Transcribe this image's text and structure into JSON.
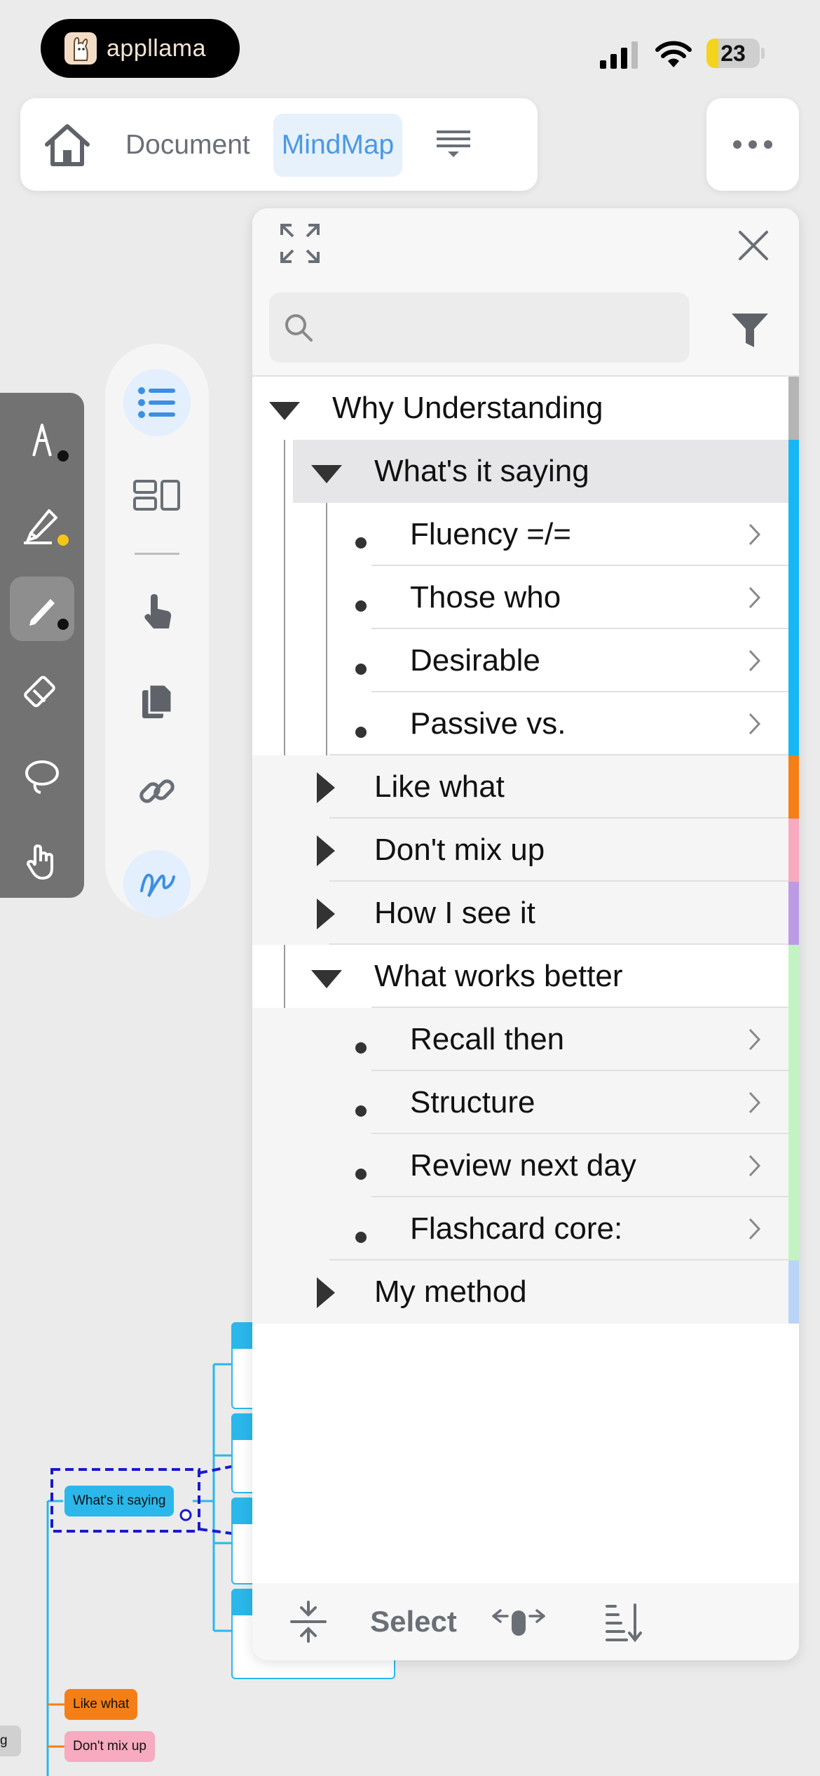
{
  "status_bar": {
    "brand": "appllama",
    "battery": "23",
    "battery_level": 0.23
  },
  "nav": {
    "tabs": [
      {
        "label": "Document",
        "active": false
      },
      {
        "label": "MindMap",
        "active": true
      }
    ],
    "icons": {
      "home": "home-icon",
      "menu": "dropdown-lines-icon",
      "more": "ellipsis-icon"
    }
  },
  "toolbar": {
    "tools": [
      "pen-icon",
      "highlighter-icon",
      "pencil-icon",
      "eraser-icon",
      "lasso-icon",
      "hand-icon"
    ],
    "active_tool": "pencil-icon",
    "dot_colors": [
      "#111111",
      "#f5c518",
      "#111111"
    ]
  },
  "palette": {
    "items": [
      "list-icon",
      "layout-icon",
      "pointer-icon",
      "document-icon",
      "link-icon",
      "scribble-icon"
    ]
  },
  "mindmap_bg": {
    "nodes": [
      "What's it saying",
      "Like what",
      "Don't mix up",
      "g"
    ]
  },
  "outline": {
    "search": {
      "placeholder": "",
      "value": ""
    },
    "rows": [
      {
        "label": "Why Understanding",
        "level": 0,
        "toggle": "expanded"
      },
      {
        "label": "What's it saying",
        "level": 1,
        "toggle": "expanded",
        "selected": true
      },
      {
        "label": "Fluency =/=",
        "level": 2,
        "toggle": "leaf"
      },
      {
        "label": "Those who",
        "level": 2,
        "toggle": "leaf"
      },
      {
        "label": "Desirable",
        "level": 2,
        "toggle": "leaf"
      },
      {
        "label": "Passive vs.",
        "level": 2,
        "toggle": "leaf"
      },
      {
        "label": "Like what",
        "level": 1,
        "toggle": "collapsed"
      },
      {
        "label": "Don't mix up",
        "level": 1,
        "toggle": "collapsed"
      },
      {
        "label": "How I see it",
        "level": 1,
        "toggle": "collapsed"
      },
      {
        "label": "What works better",
        "level": 1,
        "toggle": "expanded"
      },
      {
        "label": "Recall then",
        "level": 2,
        "toggle": "leaf"
      },
      {
        "label": "Structure",
        "level": 2,
        "toggle": "leaf"
      },
      {
        "label": "Review next day",
        "level": 2,
        "toggle": "leaf"
      },
      {
        "label": "Flashcard core:",
        "level": 2,
        "toggle": "leaf"
      },
      {
        "label": "My method",
        "level": 1,
        "toggle": "collapsed"
      }
    ],
    "branch_colors": {
      "root": "#b5b5b5",
      "whats_it_saying": "#16b7f5",
      "like_what": "#f57f17",
      "dont_mix_up": "#f7aac0",
      "how_i_see_it": "#bb9be4",
      "what_works_better": "#c3f3c3",
      "my_method": "#b9d4f6"
    },
    "footer": {
      "select_label": "Select"
    }
  }
}
